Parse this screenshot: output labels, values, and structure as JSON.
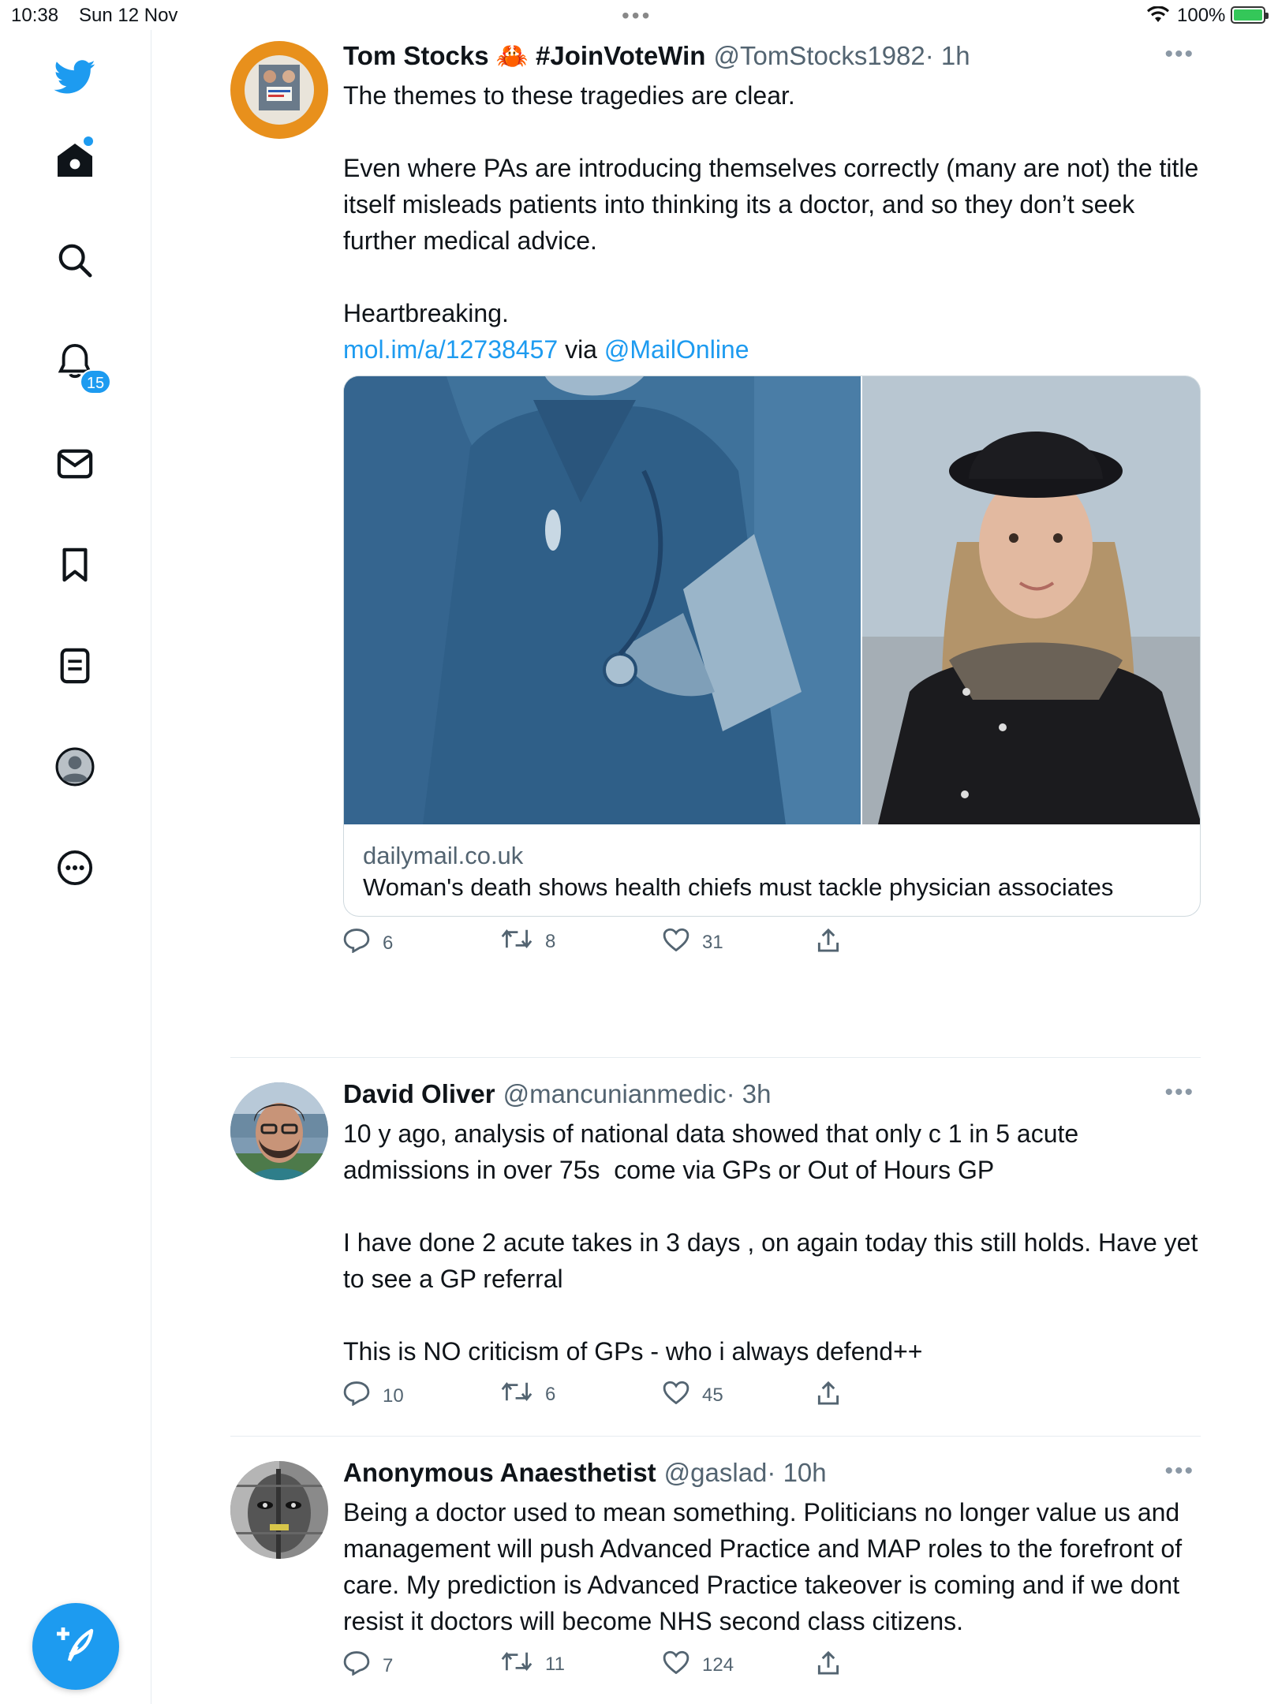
{
  "status_bar": {
    "time": "10:38",
    "date": "Sun 12 Nov",
    "battery_pct": "100%",
    "battery_color": "#34c759"
  },
  "sidebar": {
    "items": [
      {
        "icon": "twitter-logo-icon"
      },
      {
        "icon": "home-icon"
      },
      {
        "icon": "search-icon"
      },
      {
        "icon": "notifications-icon",
        "badge": "15"
      },
      {
        "icon": "messages-icon"
      },
      {
        "icon": "bookmarks-icon"
      },
      {
        "icon": "lists-icon"
      },
      {
        "icon": "profile-icon"
      },
      {
        "icon": "more-icon"
      }
    ],
    "compose_icon": "compose-feather-icon",
    "accent": "#1d9bf0"
  },
  "tweets": [
    {
      "name": "Tom Stocks 🦀 #JoinVoteWin",
      "handle": "@TomStocks1982",
      "time": " · 1h",
      "text": "The themes to these tragedies are clear.\n\nEven where PAs are introducing themselves correctly (many are not) the title itself misleads patients into thinking its a doctor, and so they don’t seek further medical advice.\n\nHeartbreaking.\n",
      "link": "mol.im/a/12738457",
      "via": " via ",
      "mention": "@MailOnline",
      "card": {
        "domain": "dailymail.co.uk",
        "title": "Woman's death shows health chiefs must tackle physician associates"
      },
      "replies": "6",
      "retweets": "8",
      "likes": "31"
    },
    {
      "name": "David Oliver",
      "handle": "@mancunianmedic",
      "time": " · 3h",
      "text": "10 y ago, analysis of national data showed that only c 1 in 5 acute admissions in over 75s  come via GPs or Out of Hours GP\n\nI have done 2 acute takes in 3 days , on again today this still holds. Have yet to see a GP referral\n\nThis is NO criticism of GPs - who i always defend++",
      "replies": "10",
      "retweets": "6",
      "likes": "45"
    },
    {
      "name": "Anonymous Anaesthetist",
      "handle": "@gaslad",
      "time": " · 10h",
      "text": "Being a doctor used to mean something. Politicians no longer value us and management will push Advanced Practice and MAP roles to the forefront of care. My prediction is Advanced Practice takeover is coming and if we dont resist it doctors will become NHS second class citizens.",
      "replies": "7",
      "retweets": "11",
      "likes": "124"
    }
  ]
}
